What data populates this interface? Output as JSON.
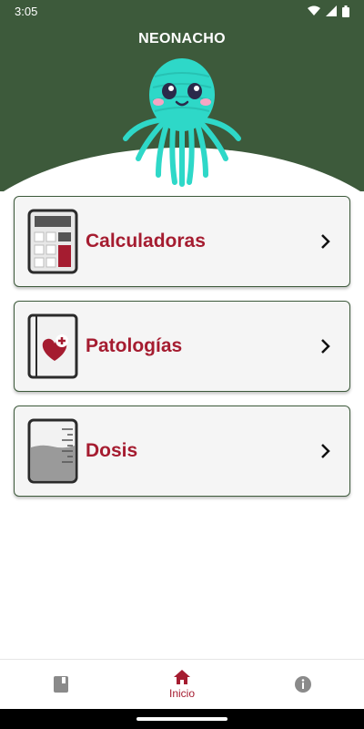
{
  "status_bar": {
    "time": "3:05",
    "icons": [
      "wifi-icon",
      "signal-icon",
      "battery-icon"
    ]
  },
  "header": {
    "title": "NEONACHO",
    "background_color": "#3d5a3b",
    "mascot": "octopus-mascot"
  },
  "menu": {
    "items": [
      {
        "label": "Calculadoras",
        "icon": "calculator-icon"
      },
      {
        "label": "Patologías",
        "icon": "heart-book-icon"
      },
      {
        "label": "Dosis",
        "icon": "measuring-cup-icon"
      }
    ]
  },
  "bottom_nav": {
    "items": [
      {
        "label": "",
        "icon": "book-icon",
        "active": false
      },
      {
        "label": "Inicio",
        "icon": "home-icon",
        "active": true
      },
      {
        "label": "",
        "icon": "info-icon",
        "active": false
      }
    ]
  },
  "colors": {
    "accent": "#a51c30",
    "header": "#3d5a3b",
    "mascot": "#2ed8c8"
  }
}
